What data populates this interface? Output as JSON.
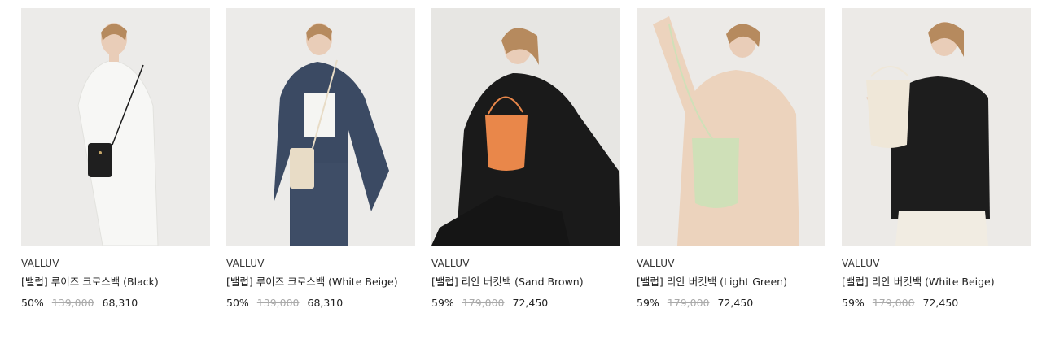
{
  "products": [
    {
      "brand": "VALLUV",
      "name": "[밸럽] 루이즈 크로스백 (Black)",
      "discount": "50%",
      "original_price": "139,000",
      "sale_price": "68,310",
      "bag_color": "#1f1f1f",
      "outfit_color": "#f7f7f5"
    },
    {
      "brand": "VALLUV",
      "name": "[밸럽] 루이즈 크로스백 (White Beige)",
      "discount": "50%",
      "original_price": "139,000",
      "sale_price": "68,310",
      "bag_color": "#e8dcc6",
      "outfit_color": "#3b4a63"
    },
    {
      "brand": "VALLUV",
      "name": "[밸럽] 리안 버킷백 (Sand Brown)",
      "discount": "59%",
      "original_price": "179,000",
      "sale_price": "72,450",
      "bag_color": "#e9874a",
      "outfit_color": "#1a1a1a"
    },
    {
      "brand": "VALLUV",
      "name": "[밸럽] 리안 버킷백 (Light Green)",
      "discount": "59%",
      "original_price": "179,000",
      "sale_price": "72,450",
      "bag_color": "#cfe0b8",
      "outfit_color": "#ecd3bd"
    },
    {
      "brand": "VALLUV",
      "name": "[밸럽] 리안 버킷백 (White Beige)",
      "discount": "59%",
      "original_price": "179,000",
      "sale_price": "72,450",
      "bag_color": "#efe7d8",
      "outfit_color": "#1d1d1d"
    }
  ]
}
